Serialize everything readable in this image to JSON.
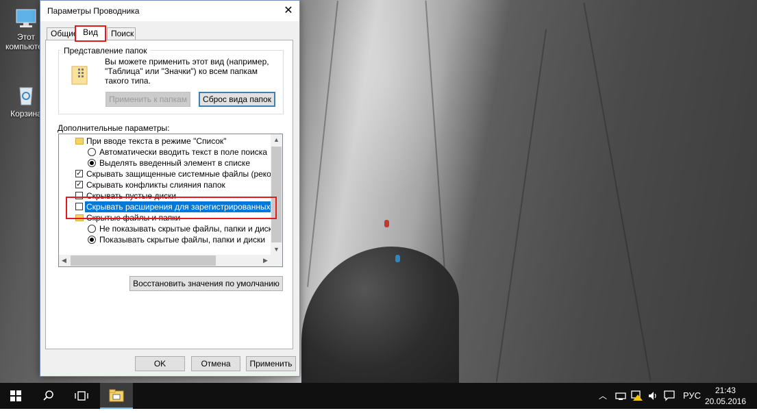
{
  "desktop": {
    "icons": [
      {
        "label": "Этот компьютер",
        "icon": "computer-icon"
      },
      {
        "label": "Корзина",
        "icon": "recycle-bin-icon"
      }
    ]
  },
  "dialog": {
    "title": "Параметры Проводника",
    "close_glyph": "✕",
    "tabs": [
      {
        "label": "Общие",
        "active": false
      },
      {
        "label": "Вид",
        "active": true
      },
      {
        "label": "Поиск",
        "active": false
      }
    ],
    "folder_views": {
      "legend": "Представление папок",
      "description": "Вы можете применить этот вид (например, \"Таблица\" или \"Значки\") ко всем папкам такого типа.",
      "apply_button": "Применить к папкам",
      "reset_button": "Сброс вида папок"
    },
    "advanced": {
      "label": "Дополнительные параметры:",
      "items": [
        {
          "type": "folder",
          "text": "При вводе текста в режиме \"Список\"",
          "level": 1
        },
        {
          "type": "radio",
          "text": "Автоматически вводить текст в поле поиска",
          "checked": false,
          "level": 2
        },
        {
          "type": "radio",
          "text": "Выделять введенный элемент в списке",
          "checked": true,
          "level": 2
        },
        {
          "type": "checkbox",
          "text": "Скрывать защищенные системные файлы (рекомен",
          "checked": true,
          "level": 1
        },
        {
          "type": "checkbox",
          "text": "Скрывать конфликты слияния папок",
          "checked": true,
          "level": 1
        },
        {
          "type": "checkbox",
          "text": "Скрывать пустые диски",
          "checked": false,
          "level": 1
        },
        {
          "type": "checkbox",
          "text": "Скрывать расширения для зарегистрированных типо",
          "checked": false,
          "level": 1,
          "selected": true
        },
        {
          "type": "folder",
          "text": "Скрытые файлы и папки",
          "level": 1
        },
        {
          "type": "radio",
          "text": "Не показывать скрытые файлы, папки и диски",
          "checked": false,
          "level": 2
        },
        {
          "type": "radio",
          "text": "Показывать скрытые файлы, папки и диски",
          "checked": true,
          "level": 2
        }
      ]
    },
    "restore_button": "Восстановить значения по умолчанию",
    "ok_button": "OK",
    "cancel_button": "Отмена",
    "apply_button": "Применить"
  },
  "taskbar": {
    "language": "РУС",
    "time": "21:43",
    "date": "20.05.2016"
  },
  "colors": {
    "accent": "#0078d7",
    "highlight_box": "#e3191b",
    "taskbar": "#101010"
  }
}
